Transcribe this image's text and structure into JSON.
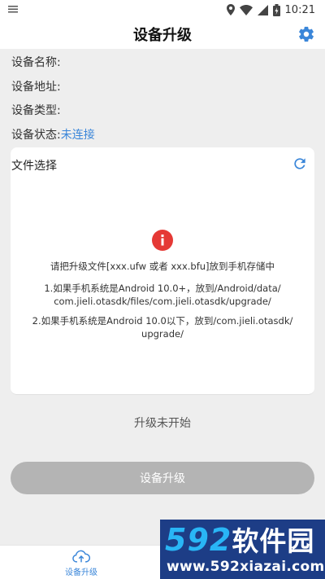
{
  "status_bar": {
    "time": "10:21",
    "icons": [
      "notification-icon",
      "location-icon",
      "wifi-icon",
      "signal-icon",
      "battery-icon"
    ]
  },
  "app_bar": {
    "title": "设备升级",
    "settings_icon": "gear-icon"
  },
  "device_info": {
    "name_label": "设备名称:",
    "address_label": "设备地址:",
    "type_label": "设备类型:",
    "status_label": "设备状态:",
    "status_value": "未连接"
  },
  "file_card": {
    "title": "文件选择",
    "refresh_icon": "refresh-icon",
    "alert_icon": "info-icon",
    "hint_main": "请把升级文件[xxx.ufw 或者 xxx.bfu]放到手机存储中",
    "hint_1_line1": "1.如果手机系统是Android 10.0+，放到/Android/data/",
    "hint_1_line2": "com.jieli.otasdk/files/com.jieli.otasdk/upgrade/",
    "hint_2_line1": "2.如果手机系统是Android 10.0以下，放到/com.jieli.otasdk/",
    "hint_2_line2": "upgrade/"
  },
  "upgrade": {
    "status_text": "升级未开始",
    "button_label": "设备升级"
  },
  "bottom_nav": {
    "items": [
      {
        "label": "设备升级",
        "icon": "cloud-upload-icon",
        "active": true
      }
    ]
  },
  "watermark": {
    "number": "592",
    "brand": "软件园",
    "url": "www.592xiazai.com"
  },
  "colors": {
    "accent": "#3a86d9",
    "alert": "#e53935",
    "button_disabled": "#b4b4b4",
    "background": "#eeeeee"
  }
}
